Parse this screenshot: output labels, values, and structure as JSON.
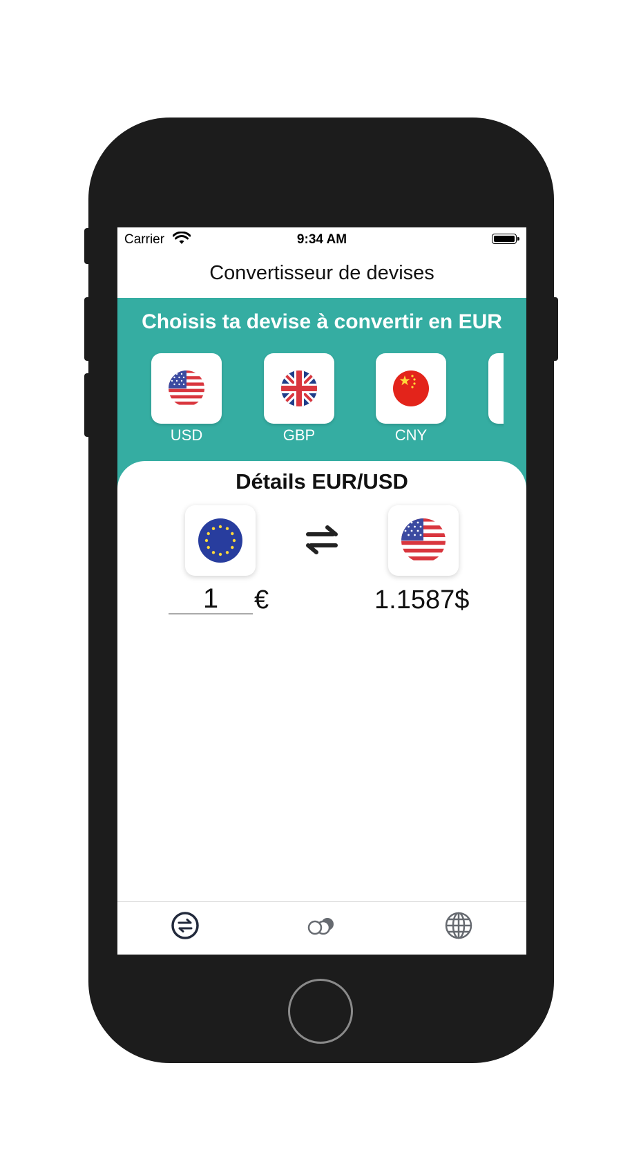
{
  "status_bar": {
    "carrier": "Carrier",
    "time": "9:34 AM"
  },
  "nav": {
    "title": "Convertisseur de devises"
  },
  "picker": {
    "title": "Choisis ta devise à convertir en EUR",
    "currencies": [
      {
        "code": "USD",
        "flag": "us-flag-icon"
      },
      {
        "code": "GBP",
        "flag": "uk-flag-icon"
      },
      {
        "code": "CNY",
        "flag": "china-flag-icon"
      }
    ]
  },
  "details": {
    "title": "Détails EUR/USD",
    "from_flag": "eu-flag-icon",
    "to_flag": "us-flag-icon",
    "amount_value": "1",
    "from_symbol": "€",
    "result": "1.1587$"
  },
  "tabbar": {
    "tabs": [
      {
        "icon": "exchange-icon",
        "selected": true
      },
      {
        "icon": "coins-icon",
        "selected": false
      },
      {
        "icon": "globe-icon",
        "selected": false
      }
    ]
  },
  "colors": {
    "accent": "#35ada2",
    "phone_body": "#1c1c1c"
  }
}
